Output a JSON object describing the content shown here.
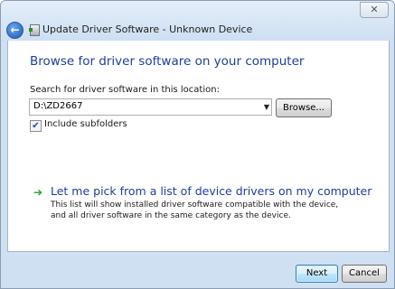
{
  "window": {
    "title": "Update Driver Software - Unknown Device",
    "close_glyph": "✕",
    "back_glyph": "←"
  },
  "main": {
    "heading": "Browse for driver software on your computer",
    "search_label": "Search for driver software in this location:",
    "location_value": "D:\\ZD2667",
    "dropdown_glyph": "▼",
    "browse_label": "Browse...",
    "include_subfolders_label": "Include subfolders",
    "include_subfolders_checked": true,
    "check_glyph": "✔",
    "pick_arrow_glyph": "➔",
    "pick_link": "Let me pick from a list of device drivers on my computer",
    "pick_description": "This list will show installed driver software compatible with the device, and all driver software in the same category as the device."
  },
  "footer": {
    "next_label": "Next",
    "cancel_label": "Cancel"
  },
  "colors": {
    "heading": "#1e3f9a",
    "pick_arrow": "#2e9b2e"
  }
}
